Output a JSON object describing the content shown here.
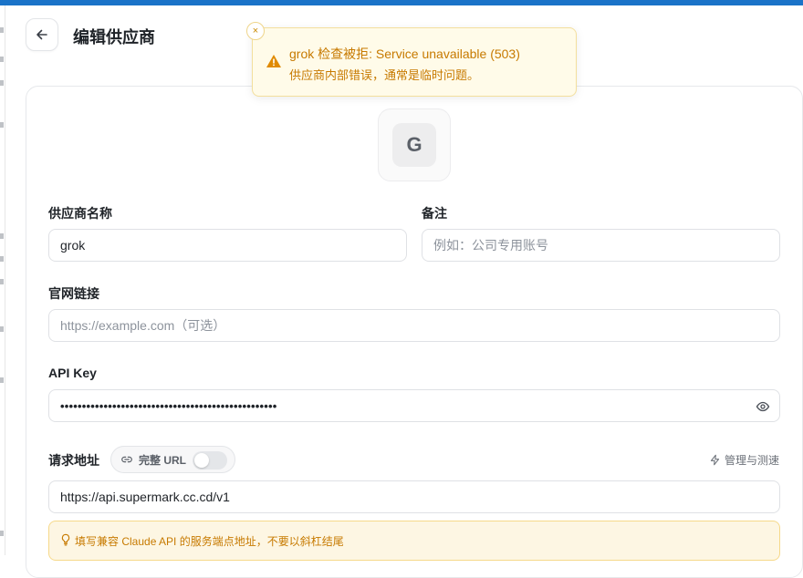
{
  "header": {
    "title": "编辑供应商",
    "back_icon": "arrow-left-icon"
  },
  "provider": {
    "logo_letter": "G"
  },
  "form": {
    "name_label": "供应商名称",
    "name_value": "grok",
    "note_label": "备注",
    "note_placeholder": "例如：公司专用账号",
    "website_label": "官网链接",
    "website_placeholder": "https://example.com（可选）",
    "apikey_label": "API Key",
    "apikey_value": "••••••••••••••••••••••••••••••••••••••••••••••••••",
    "endpoint_label": "请求地址",
    "full_url_label": "完整 URL",
    "full_url_enabled": false,
    "manage_label": "管理与测速",
    "endpoint_value": "https://api.supermark.cc.cd/v1",
    "tip_text": "填写兼容 Claude API 的服务端点地址，不要以斜杠结尾"
  },
  "toast": {
    "title": "grok 检查被拒: Service unavailable (503)",
    "description": "供应商内部错误，通常是临时问题。",
    "close_symbol": "×"
  },
  "colors": {
    "accent_bar": "#1a73c8",
    "warning": "#c77a00",
    "warning_bg": "#fffbe9"
  }
}
